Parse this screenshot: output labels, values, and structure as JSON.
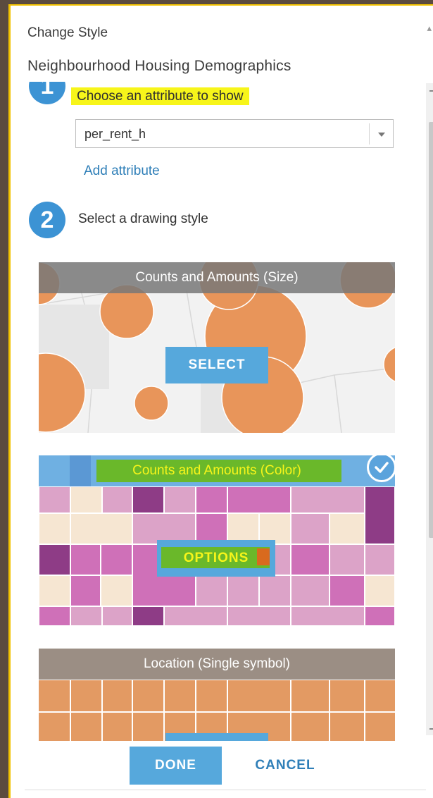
{
  "header": {
    "title": "Change Style",
    "layer_name": "Neighbourhood Housing Demographics"
  },
  "step1": {
    "number": "1",
    "label": "Choose an attribute to show",
    "attribute_value": "per_rent_h",
    "add_attribute_label": "Add attribute"
  },
  "step2": {
    "number": "2",
    "label": "Select a drawing style"
  },
  "styles": [
    {
      "title": "Counts and Amounts (Size)",
      "button_label": "SELECT",
      "selected": false
    },
    {
      "title": "Counts and Amounts (Color)",
      "button_label": "OPTIONS",
      "selected": true
    },
    {
      "title": "Location (Single symbol)",
      "button_label": "",
      "selected": false
    }
  ],
  "footer": {
    "done_label": "DONE",
    "cancel_label": "CANCEL"
  },
  "colors": {
    "accent": "#3c93d4",
    "button_blue": "#56a8dc",
    "link_blue": "#2f7fb8",
    "highlight_yellow": "#f7f51a",
    "size_symbol_orange": "#e8955a",
    "single_symbol_orange": "#e39a63",
    "choropleth": [
      "#f6e6d2",
      "#dca3c8",
      "#cf70b8",
      "#8e3c86"
    ]
  }
}
